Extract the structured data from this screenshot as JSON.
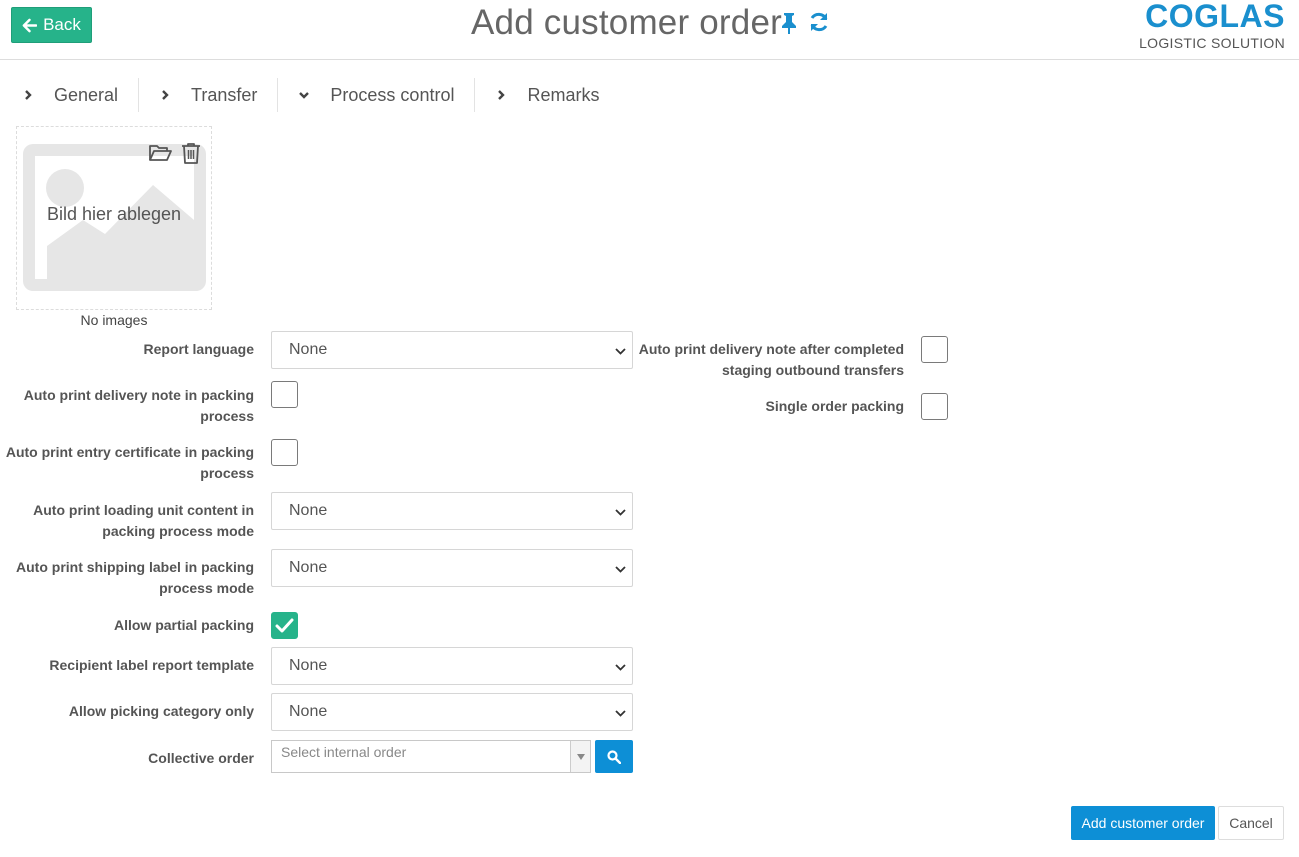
{
  "header": {
    "back_label": "Back",
    "title": "Add customer order",
    "logo_main": "COGLAS",
    "logo_sub": "LOGISTIC SOLUTION",
    "icons": [
      "arrow-left-icon",
      "pin-icon",
      "refresh-icon"
    ]
  },
  "colors": {
    "green": "#26b38a",
    "blue": "#0d8fd6",
    "logo_blue": "#1a8fce"
  },
  "tabs": [
    {
      "label": "General",
      "state": "collapsed"
    },
    {
      "label": "Transfer",
      "state": "collapsed"
    },
    {
      "label": "Process control",
      "state": "expanded"
    },
    {
      "label": "Remarks",
      "state": "collapsed"
    }
  ],
  "images": {
    "drop_text": "Bild hier ablegen",
    "empty_text": "No images",
    "icons": [
      "folder-open-icon",
      "trash-icon"
    ]
  },
  "form": {
    "report_language": {
      "label": "Report language",
      "value": "None"
    },
    "auto_print_delivery_packing": {
      "label": "Auto print delivery note in packing process",
      "checked": false
    },
    "auto_print_entry_certificate": {
      "label": "Auto print entry certificate in packing process",
      "checked": false
    },
    "auto_print_loading_unit": {
      "label": "Auto print loading unit content in packing process mode",
      "value": "None"
    },
    "auto_print_shipping_label": {
      "label": "Auto print shipping label in packing process mode",
      "value": "None"
    },
    "allow_partial_packing": {
      "label": "Allow partial packing",
      "checked": true
    },
    "recipient_label_template": {
      "label": "Recipient label report template",
      "value": "None"
    },
    "allow_picking_category": {
      "label": "Allow picking category only",
      "value": "None"
    },
    "collective_order": {
      "label": "Collective order",
      "placeholder": "Select internal order"
    },
    "auto_print_delivery_staging": {
      "label": "Auto print delivery note after completed staging outbound transfers",
      "checked": false
    },
    "single_order_packing": {
      "label": "Single order packing",
      "checked": false
    }
  },
  "footer": {
    "submit_label": "Add customer order",
    "cancel_label": "Cancel"
  }
}
